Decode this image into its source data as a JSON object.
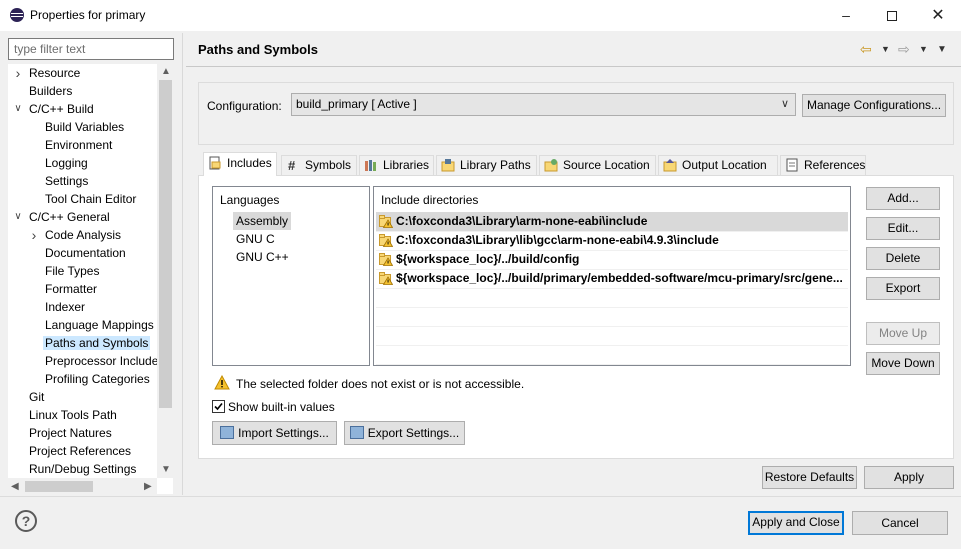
{
  "window": {
    "title": "Properties for primary"
  },
  "filter": {
    "placeholder": "type filter text"
  },
  "tree": {
    "items": [
      {
        "label": "Resource",
        "indent": 0,
        "twisty": "collapsed"
      },
      {
        "label": "Builders",
        "indent": 0
      },
      {
        "label": "C/C++ Build",
        "indent": 0,
        "twisty": "expanded"
      },
      {
        "label": "Build Variables",
        "indent": 1
      },
      {
        "label": "Environment",
        "indent": 1
      },
      {
        "label": "Logging",
        "indent": 1
      },
      {
        "label": "Settings",
        "indent": 1
      },
      {
        "label": "Tool Chain Editor",
        "indent": 1
      },
      {
        "label": "C/C++ General",
        "indent": 0,
        "twisty": "expanded"
      },
      {
        "label": "Code Analysis",
        "indent": 1,
        "twisty": "collapsed"
      },
      {
        "label": "Documentation",
        "indent": 1
      },
      {
        "label": "File Types",
        "indent": 1
      },
      {
        "label": "Formatter",
        "indent": 1
      },
      {
        "label": "Indexer",
        "indent": 1
      },
      {
        "label": "Language Mappings",
        "indent": 1
      },
      {
        "label": "Paths and Symbols",
        "indent": 1,
        "selected": true
      },
      {
        "label": "Preprocessor Include",
        "indent": 1
      },
      {
        "label": "Profiling Categories",
        "indent": 1
      },
      {
        "label": "Git",
        "indent": 0
      },
      {
        "label": "Linux Tools Path",
        "indent": 0
      },
      {
        "label": "Project Natures",
        "indent": 0
      },
      {
        "label": "Project References",
        "indent": 0
      },
      {
        "label": "Run/Debug Settings",
        "indent": 0
      }
    ]
  },
  "page": {
    "title": "Paths and Symbols"
  },
  "config": {
    "label": "Configuration:",
    "value": "build_primary  [ Active ]",
    "manage_label": "Manage Configurations..."
  },
  "tabs": [
    {
      "label": "Includes",
      "icon": "includes-icon",
      "active": true
    },
    {
      "label": "Symbols",
      "icon": "hash-icon"
    },
    {
      "label": "Libraries",
      "icon": "libraries-icon"
    },
    {
      "label": "Library Paths",
      "icon": "library-paths-icon"
    },
    {
      "label": "Source Location",
      "icon": "source-location-icon"
    },
    {
      "label": "Output Location",
      "icon": "output-location-icon"
    },
    {
      "label": "References",
      "icon": "references-icon"
    }
  ],
  "languages": {
    "header": "Languages",
    "items": [
      {
        "label": "Assembly",
        "selected": true
      },
      {
        "label": "GNU C"
      },
      {
        "label": "GNU C++"
      }
    ]
  },
  "include_dirs": {
    "header": "Include directories",
    "items": [
      {
        "path": "C:\\foxconda3\\Library\\arm-none-eabi\\include",
        "selected": true
      },
      {
        "path": "C:\\foxconda3\\Library\\lib\\gcc\\arm-none-eabi\\4.9.3\\include"
      },
      {
        "path": "${workspace_loc}/../build/config"
      },
      {
        "path": "${workspace_loc}/../build/primary/embedded-software/mcu-primary/src/gene..."
      }
    ]
  },
  "side_buttons": {
    "add": "Add...",
    "edit": "Edit...",
    "delete": "Delete",
    "export": "Export",
    "move_up": "Move Up",
    "move_down": "Move Down"
  },
  "warning": {
    "text": "The selected folder does not exist or is not accessible."
  },
  "builtin": {
    "label": "Show built-in values",
    "checked": true
  },
  "import_label": "Import Settings...",
  "export_label": "Export Settings...",
  "restore_label": "Restore Defaults",
  "apply_label": "Apply",
  "apply_close_label": "Apply and Close",
  "cancel_label": "Cancel",
  "colors": {
    "selection": "#cce8ff",
    "default_border": "#0078d7",
    "folder": "#f8d775"
  }
}
